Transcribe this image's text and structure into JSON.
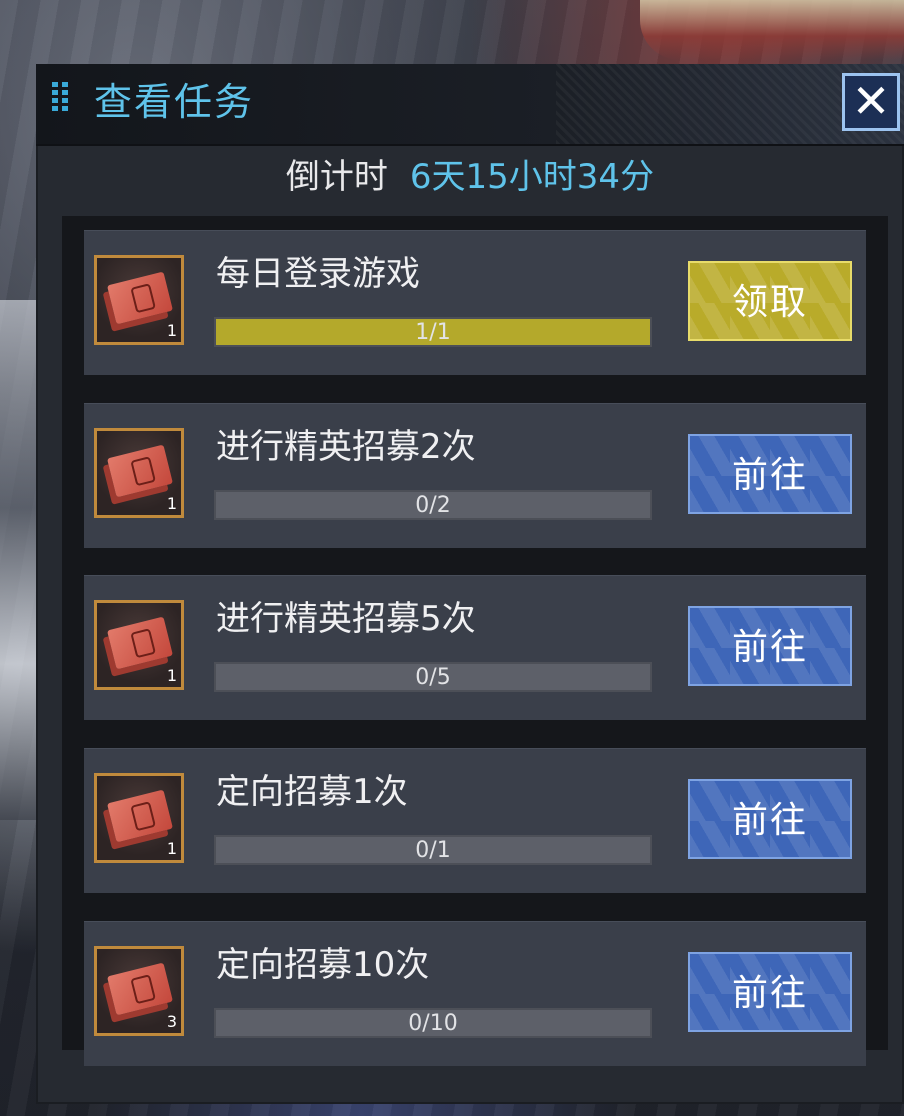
{
  "panel": {
    "title": "查看任务",
    "close_label": "✕",
    "countdown_label": "倒计时",
    "countdown_value": "6天15小时34分"
  },
  "colors": {
    "accent": "#5fc3ea",
    "claim_button": "#b9ab2a",
    "go_button": "#3e66b8",
    "progress_fill": "#b4a92b"
  },
  "tasks": [
    {
      "title": "每日登录游戏",
      "progress_text": "1/1",
      "progress_fraction": 1.0,
      "reward_icon": "recruit-ticket-icon",
      "reward_count": "1",
      "button_label": "领取",
      "button_type": "claim"
    },
    {
      "title": "进行精英招募2次",
      "progress_text": "0/2",
      "progress_fraction": 0.0,
      "reward_icon": "recruit-ticket-icon",
      "reward_count": "1",
      "button_label": "前往",
      "button_type": "go"
    },
    {
      "title": "进行精英招募5次",
      "progress_text": "0/5",
      "progress_fraction": 0.0,
      "reward_icon": "recruit-ticket-icon",
      "reward_count": "1",
      "button_label": "前往",
      "button_type": "go"
    },
    {
      "title": "定向招募1次",
      "progress_text": "0/1",
      "progress_fraction": 0.0,
      "reward_icon": "recruit-ticket-icon",
      "reward_count": "1",
      "button_label": "前往",
      "button_type": "go"
    },
    {
      "title": "定向招募10次",
      "progress_text": "0/10",
      "progress_fraction": 0.0,
      "reward_icon": "recruit-ticket-icon",
      "reward_count": "3",
      "button_label": "前往",
      "button_type": "go"
    }
  ]
}
